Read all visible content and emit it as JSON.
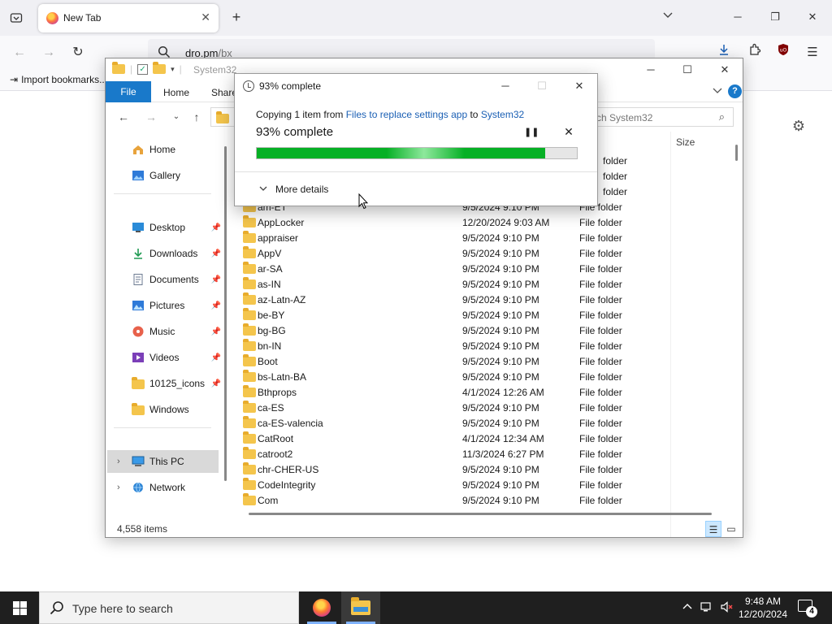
{
  "browser": {
    "tab_title": "New Tab",
    "url": "dro.pm/bx",
    "url_host": "dro.pm",
    "url_path": "/bx",
    "bookmark_import": "Import bookmarks...",
    "icons": [
      "tab-list-icon",
      "firefox-favicon",
      "close-icon",
      "plus-icon",
      "chevron-down-icon",
      "minimize-icon",
      "restore-icon",
      "close-icon",
      "back-icon",
      "forward-icon",
      "reload-icon",
      "search-icon",
      "download-icon",
      "extensions-icon",
      "ublock-icon",
      "menu-icon",
      "gear-icon"
    ]
  },
  "explorer": {
    "title": "System32",
    "ribbon": {
      "file": "File",
      "home": "Home",
      "share": "Share"
    },
    "search_placeholder": "Search System32",
    "search_visible": "ch System32",
    "column_size": "Size",
    "nav": {
      "home": "Home",
      "gallery": "Gallery",
      "desktop": "Desktop",
      "downloads": "Downloads",
      "documents": "Documents",
      "pictures": "Pictures",
      "music": "Music",
      "videos": "Videos",
      "icons_folder": "10125_icons",
      "windows": "Windows",
      "this_pc": "This PC",
      "network": "Network"
    },
    "partial_rows": {
      "row1_type": "folder",
      "row2_type": "folder",
      "row3_type": "folder",
      "row4_name": "am-ET",
      "row4_date": "9/5/2024 9:10 PM",
      "row4_type": "File folder"
    },
    "rows": [
      {
        "name": "AppLocker",
        "date": "12/20/2024 9:03 AM",
        "type": "File folder"
      },
      {
        "name": "appraiser",
        "date": "9/5/2024 9:10 PM",
        "type": "File folder"
      },
      {
        "name": "AppV",
        "date": "9/5/2024 9:10 PM",
        "type": "File folder"
      },
      {
        "name": "ar-SA",
        "date": "9/5/2024 9:10 PM",
        "type": "File folder"
      },
      {
        "name": "as-IN",
        "date": "9/5/2024 9:10 PM",
        "type": "File folder"
      },
      {
        "name": "az-Latn-AZ",
        "date": "9/5/2024 9:10 PM",
        "type": "File folder"
      },
      {
        "name": "be-BY",
        "date": "9/5/2024 9:10 PM",
        "type": "File folder"
      },
      {
        "name": "bg-BG",
        "date": "9/5/2024 9:10 PM",
        "type": "File folder"
      },
      {
        "name": "bn-IN",
        "date": "9/5/2024 9:10 PM",
        "type": "File folder"
      },
      {
        "name": "Boot",
        "date": "9/5/2024 9:10 PM",
        "type": "File folder"
      },
      {
        "name": "bs-Latn-BA",
        "date": "9/5/2024 9:10 PM",
        "type": "File folder"
      },
      {
        "name": "Bthprops",
        "date": "4/1/2024 12:26 AM",
        "type": "File folder"
      },
      {
        "name": "ca-ES",
        "date": "9/5/2024 9:10 PM",
        "type": "File folder"
      },
      {
        "name": "ca-ES-valencia",
        "date": "9/5/2024 9:10 PM",
        "type": "File folder"
      },
      {
        "name": "CatRoot",
        "date": "4/1/2024 12:34 AM",
        "type": "File folder"
      },
      {
        "name": "catroot2",
        "date": "11/3/2024 6:27 PM",
        "type": "File folder"
      },
      {
        "name": "chr-CHER-US",
        "date": "9/5/2024 9:10 PM",
        "type": "File folder"
      },
      {
        "name": "CodeIntegrity",
        "date": "9/5/2024 9:10 PM",
        "type": "File folder"
      },
      {
        "name": "Com",
        "date": "9/5/2024 9:10 PM",
        "type": "File folder"
      }
    ],
    "status_count": "4,558 items"
  },
  "dialog": {
    "title": "93% complete",
    "copying_prefix": "Copying 1 item from ",
    "source": "Files to replace settings app",
    "to": " to ",
    "destination": "System32",
    "percent_label": "93% complete",
    "progress": 0.9,
    "more_details": "More details"
  },
  "taskbar": {
    "search_placeholder": "Type here to search",
    "time": "9:48 AM",
    "date": "12/20/2024",
    "notification_count": "4"
  }
}
